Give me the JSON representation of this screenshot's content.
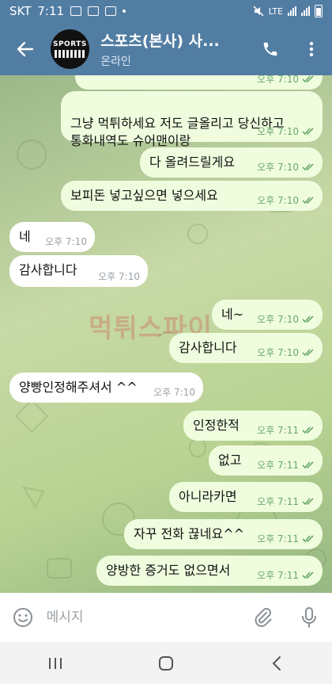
{
  "status": {
    "carrier": "SKT",
    "time": "7:11",
    "network": "LTE"
  },
  "header": {
    "title": "스포츠(본사) 사...",
    "subtitle": "온라인",
    "avatar_text": "SPORTS"
  },
  "messages": [
    {
      "text": "",
      "time": "오후 7:10",
      "dir": "out"
    },
    {
      "text": "그냥 먹튀하세요 저도 글올리고 당신하고\n통화내역도 슈어맨이랑",
      "time": "오후 7:10",
      "dir": "out"
    },
    {
      "text": "다 올려드릴게요",
      "time": "오후 7:10",
      "dir": "out"
    },
    {
      "text": "보피돈 넣고싶으면 넣으세요",
      "time": "오후 7:10",
      "dir": "out"
    },
    {
      "text": "네",
      "time": "오후 7:10",
      "dir": "in"
    },
    {
      "text": "감사합니다",
      "time": "오후 7:10",
      "dir": "in"
    },
    {
      "text": "네~",
      "time": "오후 7:10",
      "dir": "out"
    },
    {
      "text": "감사합니다",
      "time": "오후 7:10",
      "dir": "out"
    },
    {
      "text": "양빵인정해주셔서 ^^",
      "time": "오후 7:10",
      "dir": "in"
    },
    {
      "text": "인정한적",
      "time": "오후 7:11",
      "dir": "out"
    },
    {
      "text": "없고",
      "time": "오후 7:11",
      "dir": "out"
    },
    {
      "text": "아니라카면",
      "time": "오후 7:11",
      "dir": "out"
    },
    {
      "text": "자꾸 전화 끊네요^^",
      "time": "오후 7:11",
      "dir": "out"
    },
    {
      "text": "양방한 증거도 없으면서",
      "time": "오후 7:11",
      "dir": "out"
    }
  ],
  "watermark": "먹튀스파이",
  "input": {
    "placeholder": "메시지"
  },
  "colors": {
    "header": "#527da3",
    "outgoing_bubble": "#effdde",
    "incoming_bubble": "#ffffff",
    "read_ticks": "#6aa86a"
  },
  "icons": {
    "back": "arrow-left-icon",
    "call": "phone-icon",
    "emoji": "smiley-icon",
    "attach": "paperclip-icon",
    "voice": "microphone-icon"
  }
}
